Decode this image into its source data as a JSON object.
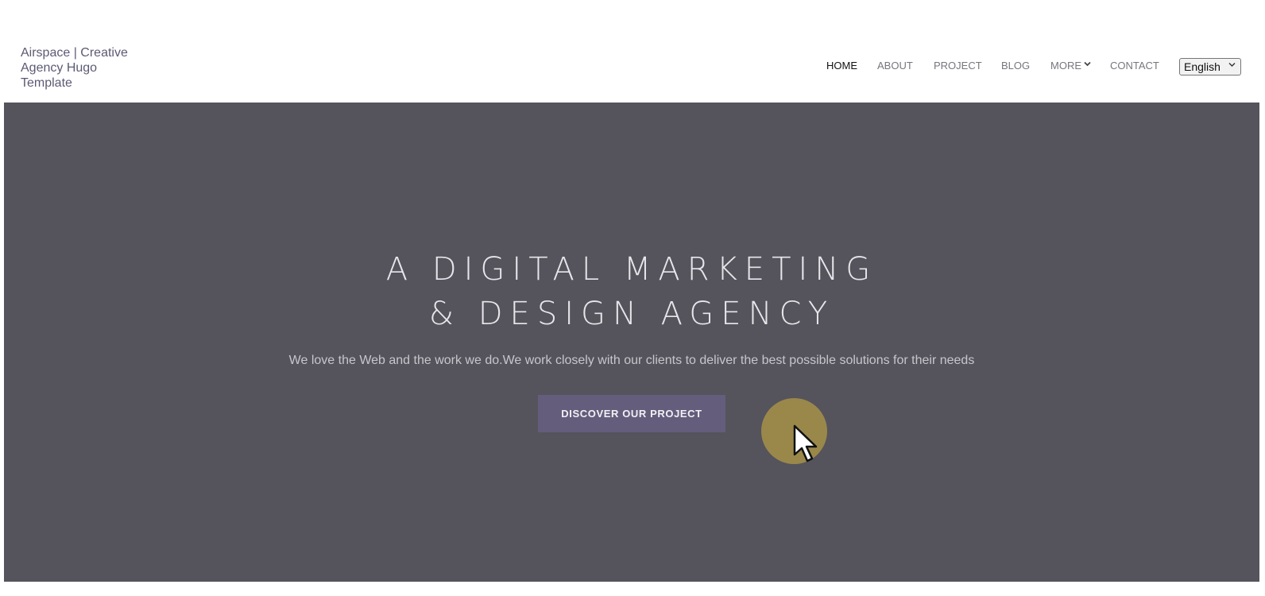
{
  "brand": {
    "title": "Airspace | Creative Agency Hugo Template"
  },
  "nav": {
    "items": [
      {
        "label": "HOME",
        "active": true
      },
      {
        "label": "ABOUT",
        "active": false
      },
      {
        "label": "PROJECT",
        "active": false
      },
      {
        "label": "BLOG",
        "active": false
      },
      {
        "label": "MORE",
        "active": false,
        "icon": "chevron-down-icon"
      },
      {
        "label": "CONTACT",
        "active": false
      }
    ],
    "language": {
      "selected": "English"
    }
  },
  "hero": {
    "title_line1": "A DIGITAL MARKETING",
    "title_line2": "& DESIGN AGENCY",
    "subtitle": "We love the Web and the work we do.We work closely with our clients to deliver the best possible solutions for their needs",
    "button_label": "DISCOVER OUR PROJECT"
  },
  "colors": {
    "hero_bg": "#55535c",
    "button_bg": "#655d7c",
    "brand_text": "#5c5a73",
    "cursor_highlight": "#9a884b"
  }
}
